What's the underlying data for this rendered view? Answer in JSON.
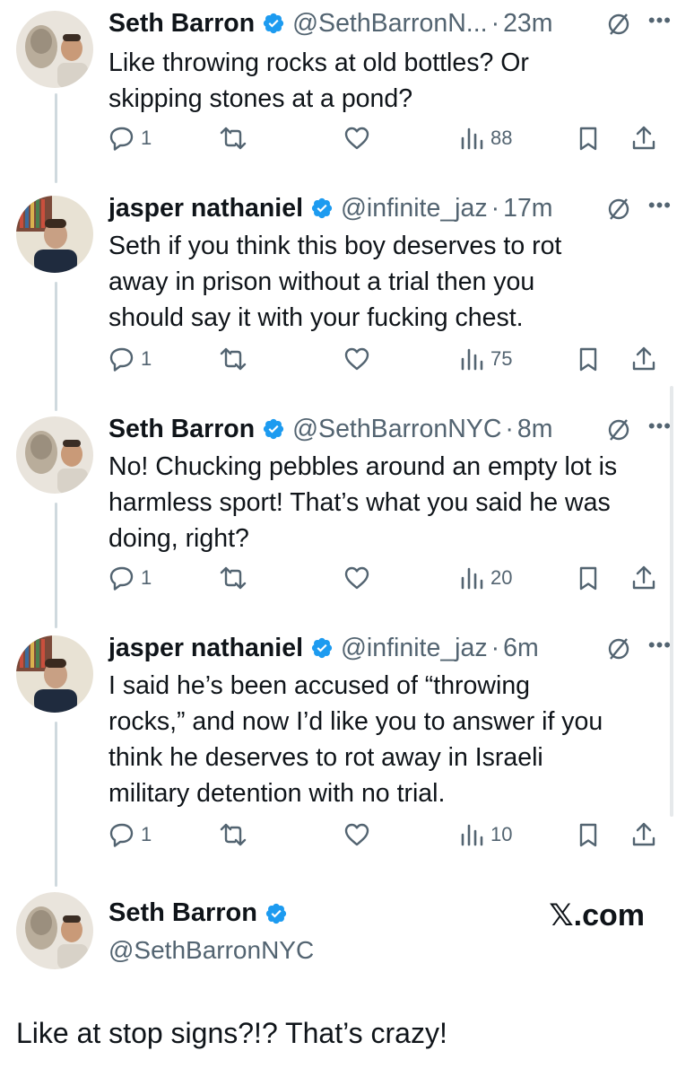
{
  "colors": {
    "verified": "#1d9bf0",
    "muted": "#536471",
    "text": "#0f1419",
    "line": "#cfd9de"
  },
  "replies": [
    {
      "name": "Seth Barron",
      "handle": "@SethBarronN...",
      "sep": "·",
      "time": "23m",
      "lines": [
        "Like throwing rocks at old bottles? Or",
        "skipping stones at a pond?"
      ],
      "replies_count": "1",
      "views": "88",
      "avatar": "statue-and-man-avatar"
    },
    {
      "name": "jasper nathaniel",
      "handle": "@infinite_jaz",
      "sep": "·",
      "time": "17m",
      "lines": [
        "Seth if you think this boy deserves to rot",
        "away in prison without a trial then you",
        "should say it with your fucking chest."
      ],
      "replies_count": "1",
      "views": "75",
      "avatar": "man-bookshelf-avatar"
    },
    {
      "name": "Seth Barron",
      "handle": "@SethBarronNYC",
      "sep": "·",
      "time": "8m",
      "lines": [
        "No! Chucking pebbles around an empty lot is",
        "harmless sport! That’s what you said he was",
        "doing, right?"
      ],
      "replies_count": "1",
      "views": "20",
      "avatar": "statue-and-man-avatar"
    },
    {
      "name": "jasper nathaniel",
      "handle": "@infinite_jaz",
      "sep": "·",
      "time": "6m",
      "lines": [
        "I said he’s been accused of “throwing",
        "rocks,” and now I’d like you to answer if you",
        "think he deserves to rot away in Israeli",
        "military detention with no trial."
      ],
      "replies_count": "1",
      "views": "10",
      "avatar": "man-bookshelf-avatar"
    }
  ],
  "main": {
    "name": "Seth Barron",
    "handle": "@SethBarronNYC",
    "watermark": "𝕏.com",
    "text": "Like at stop signs?!? That’s crazy!"
  }
}
